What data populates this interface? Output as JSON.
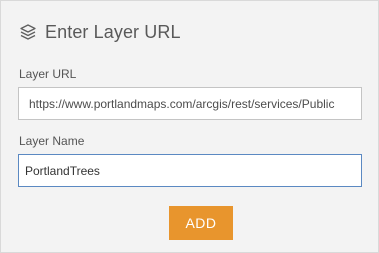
{
  "header": {
    "icon": "layers-icon",
    "title": "Enter Layer URL"
  },
  "form": {
    "url_label": "Layer URL",
    "url_value": "https://www.portlandmaps.com/arcgis/rest/services/Public",
    "name_label": "Layer Name",
    "name_value": "PortlandTrees"
  },
  "actions": {
    "add_label": "ADD"
  },
  "colors": {
    "panel_bg": "#f3f3f3",
    "accent": "#e8952d",
    "focus_border": "#5b89c2"
  }
}
